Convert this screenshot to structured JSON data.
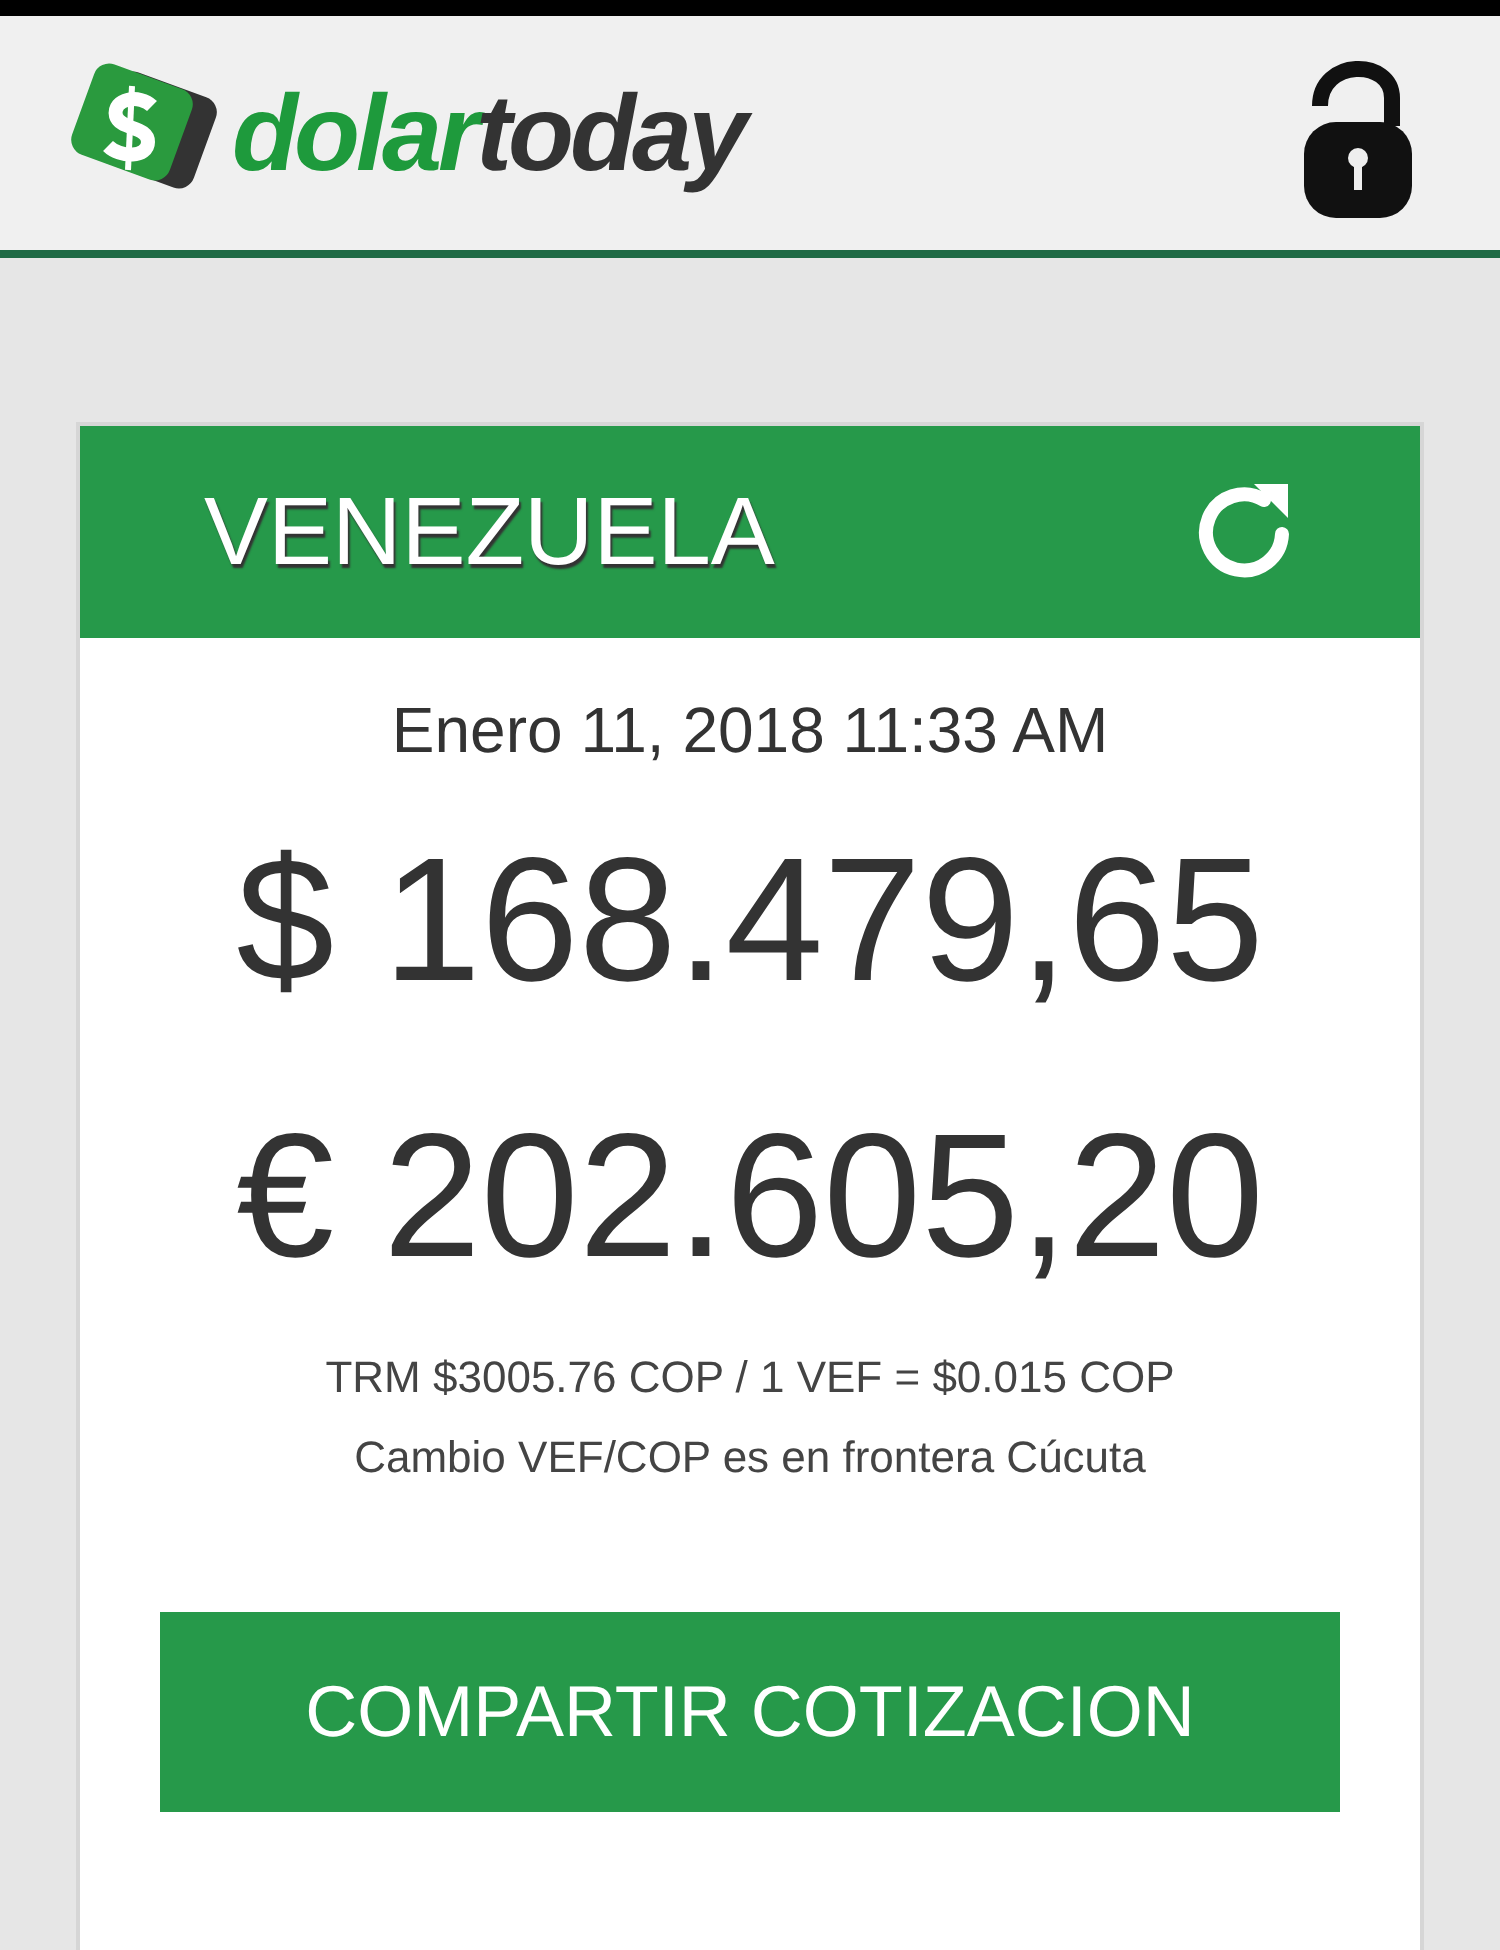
{
  "header": {
    "logo_green": "dolar",
    "logo_dark": "today"
  },
  "card": {
    "country": "VENEZUELA",
    "date": "Enero 11, 2018 11:33 AM",
    "prices": [
      {
        "symbol": "$",
        "amount": "168.479,65"
      },
      {
        "symbol": "€",
        "amount": "202.605,20"
      }
    ],
    "notes": [
      "TRM $3005.76 COP / 1 VEF = $0.015 COP",
      "Cambio VEF/COP es en frontera Cúcuta"
    ],
    "button": "COMPARTIR COTIZACION"
  }
}
